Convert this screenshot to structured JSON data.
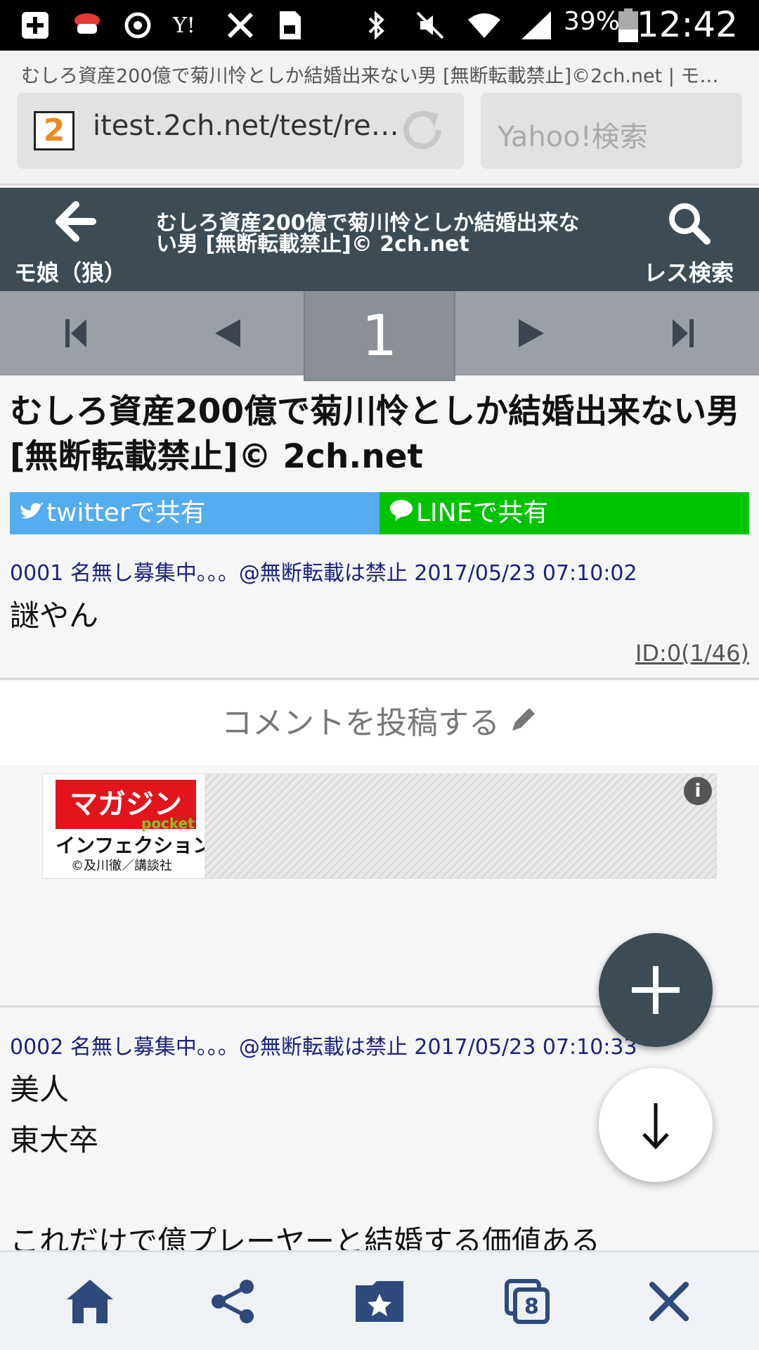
{
  "status_bar": {
    "battery": "39%",
    "time": "12:42",
    "icons": [
      "add-box-icon",
      "sushi-app-icon",
      "sync-icon",
      "yahoo-icon",
      "tools-icon",
      "sd-card-icon",
      "bluetooth-icon",
      "mute-icon",
      "wifi-icon",
      "signal-icon",
      "battery-icon"
    ]
  },
  "browser": {
    "page_title": "むしろ資産200億で菊川怜としか結婚出来ない男 [無断転載禁止]©2ch.net | モ…",
    "favicon": "2",
    "url": "itest.2ch.net/test/re…",
    "search_placeholder": "Yahoo!検索"
  },
  "header": {
    "back_label": "モ娘（狼）",
    "title": "むしろ資産200億で菊川怜としか結婚出来ない男 [無断転載禁止]© 2ch.net",
    "search_label": "レス検索"
  },
  "pager": {
    "current_page": "1"
  },
  "thread": {
    "title": "むしろ資産200億で菊川怜としか結婚出来ない男 [無断転載禁止]© 2ch.net",
    "twitter_label": "twitterで共有",
    "line_label": "LINEで共有"
  },
  "posts": [
    {
      "header": "0001 名無し募集中。。。@無断転載は禁止 2017/05/23 07:10:02",
      "body": [
        "謎やん"
      ],
      "id": "ID:0(1/46)"
    },
    {
      "header": "0002 名無し募集中。。。@無断転載は禁止 2017/05/23 07:10:33",
      "body": [
        "美人",
        "東大卒",
        "",
        "これだけで億プレーヤーと結婚する価値ある"
      ]
    }
  ],
  "comment": {
    "label": "コメントを投稿する"
  },
  "ad": {
    "logo": "マガジン",
    "logo_sub": "pocket",
    "title": "インフェクション",
    "credit": "©及川徹／講談社",
    "info": "i"
  },
  "colors": {
    "header_bg": "#3d4b55",
    "twitter": "#55acee",
    "line": "#00c300",
    "post_header": "#1a237e"
  },
  "bottom_nav": {
    "tab_count": "8",
    "icons": [
      "home-icon",
      "share-icon",
      "bookmark-folder-icon",
      "tabs-icon",
      "close-icon"
    ]
  }
}
